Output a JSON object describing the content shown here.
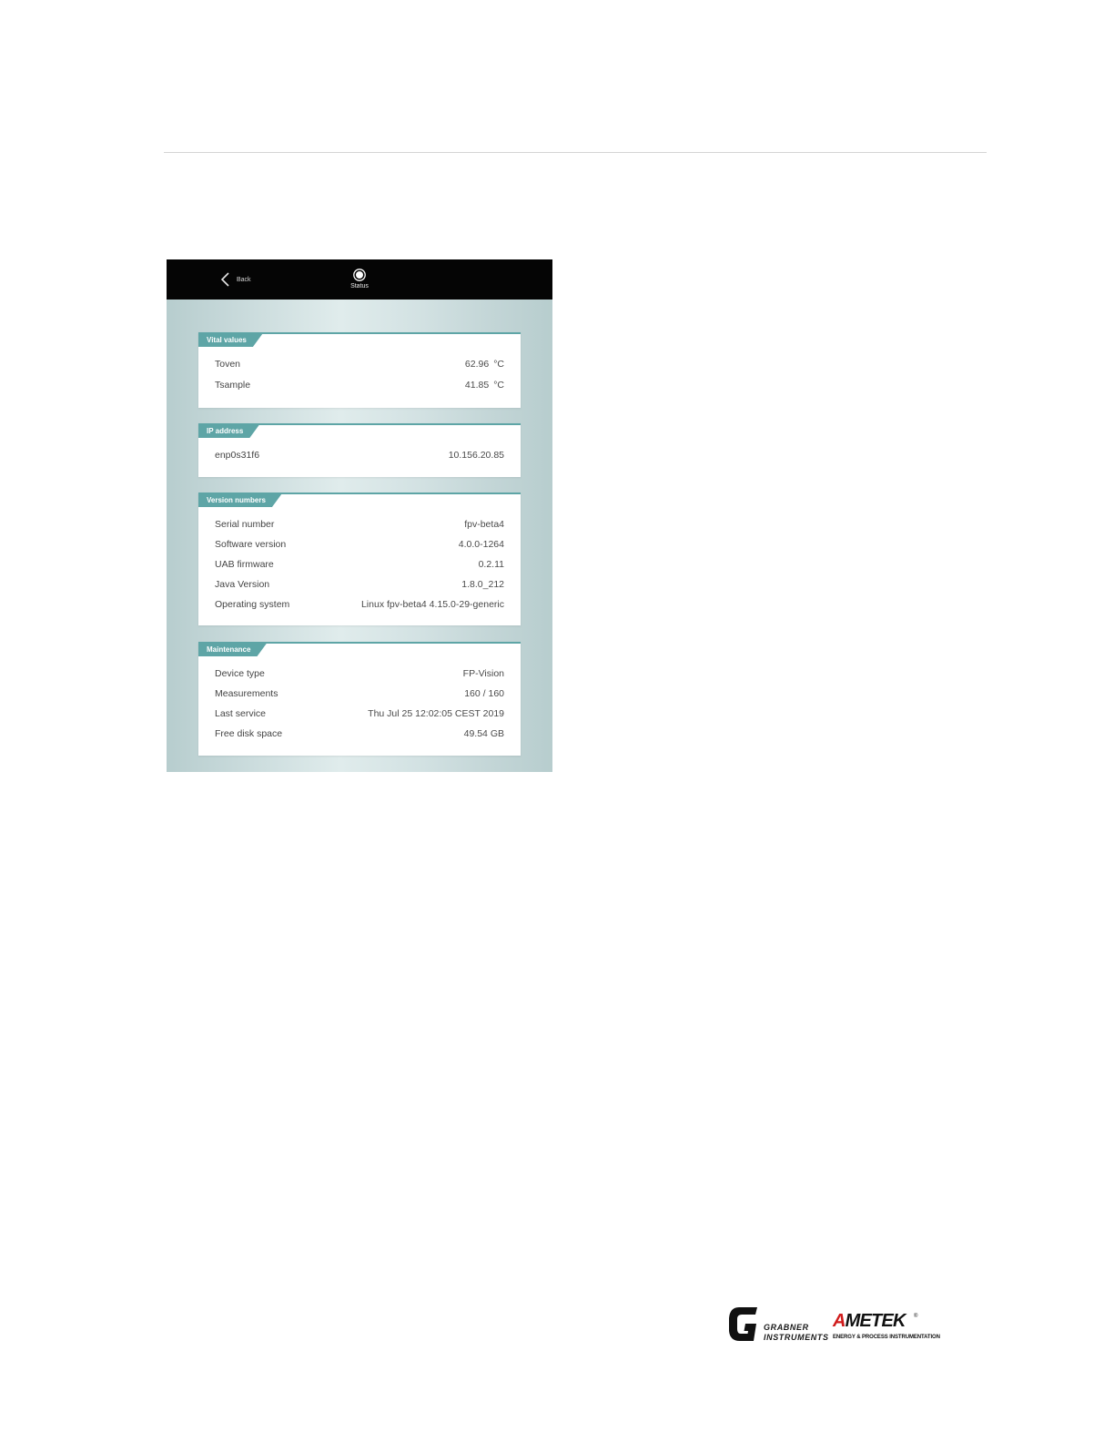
{
  "topbar": {
    "back_label": "Back",
    "status_label": "Status"
  },
  "sections": {
    "vital": {
      "title": "Vital values",
      "rows": [
        {
          "label": "Toven",
          "value": "62.96",
          "unit": "°C"
        },
        {
          "label": "Tsample",
          "value": "41.85",
          "unit": "°C"
        }
      ]
    },
    "ip": {
      "title": "IP address",
      "rows": [
        {
          "label": "enp0s31f6",
          "value": "10.156.20.85"
        }
      ]
    },
    "version": {
      "title": "Version numbers",
      "rows": [
        {
          "label": "Serial number",
          "value": "fpv-beta4"
        },
        {
          "label": "Software version",
          "value": "4.0.0-1264"
        },
        {
          "label": "UAB firmware",
          "value": "0.2.11"
        },
        {
          "label": "Java Version",
          "value": "1.8.0_212"
        },
        {
          "label": "Operating system",
          "value": "Linux fpv-beta4 4.15.0-29-generic"
        }
      ]
    },
    "maintenance": {
      "title": "Maintenance",
      "rows": [
        {
          "label": "Device type",
          "value": "FP-Vision"
        },
        {
          "label": "Measurements",
          "value": "160 / 160"
        },
        {
          "label": "Last service",
          "value": "Thu Jul 25 12:02:05 CEST 2019"
        },
        {
          "label": "Free disk space",
          "value": "49.54 GB"
        }
      ]
    }
  },
  "logos": {
    "grabner_line1": "GRABNER",
    "grabner_line2": "INSTRUMENTS",
    "ametek_first": "A",
    "ametek_rest": "METEK",
    "ametek_reg": "®",
    "ametek_sub": "ENERGY & PROCESS INSTRUMENTATION"
  },
  "colors": {
    "accent_teal": "#5ea5a6",
    "topbar": "#050505",
    "ametek_red": "#d01c1c"
  }
}
